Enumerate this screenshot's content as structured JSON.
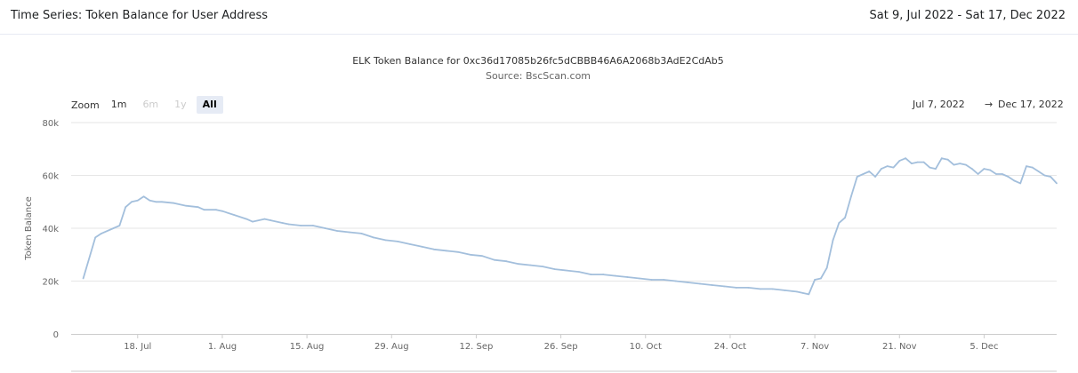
{
  "header": {
    "title": "Time Series: Token Balance for User Address",
    "date_range": "Sat 9, Jul 2022 - Sat 17, Dec 2022"
  },
  "zoom": {
    "label": "Zoom",
    "buttons": [
      {
        "label": "1m",
        "state": "enabled"
      },
      {
        "label": "6m",
        "state": "disabled"
      },
      {
        "label": "1y",
        "state": "disabled"
      },
      {
        "label": "All",
        "state": "active"
      }
    ]
  },
  "range": {
    "from": "Jul 7, 2022",
    "arrow": "→",
    "to": "Dec 17, 2022"
  },
  "colors": {
    "line": "#a3bfdc",
    "grid": "#e6e6e6",
    "axis": "#cccccc"
  },
  "chart_data": {
    "type": "line",
    "title": "ELK Token Balance for 0xc36d17085b26fc5dCBBB46A6A2068b3AdE2CdAb5",
    "subtitle": "Source: BscScan.com",
    "xlabel": "",
    "ylabel": "Token Balance",
    "xlim": [
      "2022-07-07",
      "2022-12-17"
    ],
    "ylim": [
      0,
      80000
    ],
    "grid": true,
    "legend": "none",
    "x_ticks": [
      {
        "date": "2022-07-18",
        "label": "18. Jul"
      },
      {
        "date": "2022-08-01",
        "label": "1. Aug"
      },
      {
        "date": "2022-08-15",
        "label": "15. Aug"
      },
      {
        "date": "2022-08-29",
        "label": "29. Aug"
      },
      {
        "date": "2022-09-12",
        "label": "12. Sep"
      },
      {
        "date": "2022-09-26",
        "label": "26. Sep"
      },
      {
        "date": "2022-10-10",
        "label": "10. Oct"
      },
      {
        "date": "2022-10-24",
        "label": "24. Oct"
      },
      {
        "date": "2022-11-07",
        "label": "7. Nov"
      },
      {
        "date": "2022-11-21",
        "label": "21. Nov"
      },
      {
        "date": "2022-12-05",
        "label": "5. Dec"
      }
    ],
    "y_ticks": [
      {
        "value": 0,
        "label": "0"
      },
      {
        "value": 20000,
        "label": "20k"
      },
      {
        "value": 40000,
        "label": "40k"
      },
      {
        "value": 60000,
        "label": "60k"
      },
      {
        "value": 80000,
        "label": "80k"
      }
    ],
    "series": [
      {
        "x": [
          "2022-07-09",
          "2022-07-11",
          "2022-07-12",
          "2022-07-14",
          "2022-07-15",
          "2022-07-16",
          "2022-07-17",
          "2022-07-18",
          "2022-07-19",
          "2022-07-20",
          "2022-07-21",
          "2022-07-22",
          "2022-07-24",
          "2022-07-26",
          "2022-07-28",
          "2022-07-29",
          "2022-07-31",
          "2022-08-01",
          "2022-08-03",
          "2022-08-05",
          "2022-08-06",
          "2022-08-08",
          "2022-08-09",
          "2022-08-11",
          "2022-08-12",
          "2022-08-14",
          "2022-08-16",
          "2022-08-18",
          "2022-08-20",
          "2022-08-22",
          "2022-08-24",
          "2022-08-26",
          "2022-08-28",
          "2022-08-30",
          "2022-09-01",
          "2022-09-03",
          "2022-09-05",
          "2022-09-07",
          "2022-09-09",
          "2022-09-11",
          "2022-09-13",
          "2022-09-15",
          "2022-09-17",
          "2022-09-19",
          "2022-09-21",
          "2022-09-23",
          "2022-09-25",
          "2022-09-27",
          "2022-09-29",
          "2022-10-01",
          "2022-10-03",
          "2022-10-05",
          "2022-10-07",
          "2022-10-09",
          "2022-10-11",
          "2022-10-13",
          "2022-10-15",
          "2022-10-17",
          "2022-10-19",
          "2022-10-21",
          "2022-10-23",
          "2022-10-25",
          "2022-10-27",
          "2022-10-29",
          "2022-10-31",
          "2022-11-02",
          "2022-11-04",
          "2022-11-05",
          "2022-11-06",
          "2022-11-07",
          "2022-11-08",
          "2022-11-09",
          "2022-11-10",
          "2022-11-11",
          "2022-11-12",
          "2022-11-13",
          "2022-11-14",
          "2022-11-15",
          "2022-11-16",
          "2022-11-17",
          "2022-11-18",
          "2022-11-19",
          "2022-11-20",
          "2022-11-21",
          "2022-11-22",
          "2022-11-23",
          "2022-11-24",
          "2022-11-25",
          "2022-11-26",
          "2022-11-27",
          "2022-11-28",
          "2022-11-29",
          "2022-11-30",
          "2022-12-01",
          "2022-12-02",
          "2022-12-03",
          "2022-12-04",
          "2022-12-05",
          "2022-12-06",
          "2022-12-07",
          "2022-12-08",
          "2022-12-09",
          "2022-12-10",
          "2022-12-11",
          "2022-12-12",
          "2022-12-13",
          "2022-12-14",
          "2022-12-15",
          "2022-12-16",
          "2022-12-17"
        ],
        "values": [
          21000,
          36500,
          38000,
          40000,
          41000,
          48000,
          50000,
          50500,
          52000,
          50500,
          50000,
          50000,
          49500,
          48500,
          48000,
          47000,
          47000,
          46500,
          45000,
          43500,
          42500,
          43500,
          43000,
          42000,
          41500,
          41000,
          41000,
          40000,
          39000,
          38500,
          38000,
          36500,
          35500,
          35000,
          34000,
          33000,
          32000,
          31500,
          31000,
          30000,
          29500,
          28000,
          27500,
          26500,
          26000,
          25500,
          24500,
          24000,
          23500,
          22500,
          22500,
          22000,
          21500,
          21000,
          20500,
          20500,
          20000,
          19500,
          19000,
          18500,
          18000,
          17500,
          17500,
          17000,
          17000,
          16500,
          16000,
          15500,
          15000,
          20500,
          21000,
          25000,
          35500,
          42000,
          44000,
          52000,
          59500,
          60500,
          61500,
          59500,
          62500,
          63500,
          63000,
          65500,
          66500,
          64500,
          65000,
          65000,
          63000,
          62500,
          66500,
          66000,
          64000,
          64500,
          64000,
          62500,
          60500,
          62500,
          62000,
          60500,
          60500,
          59500,
          58000,
          57000,
          63500,
          63000,
          61500,
          60000,
          59500,
          57000
        ]
      }
    ]
  }
}
